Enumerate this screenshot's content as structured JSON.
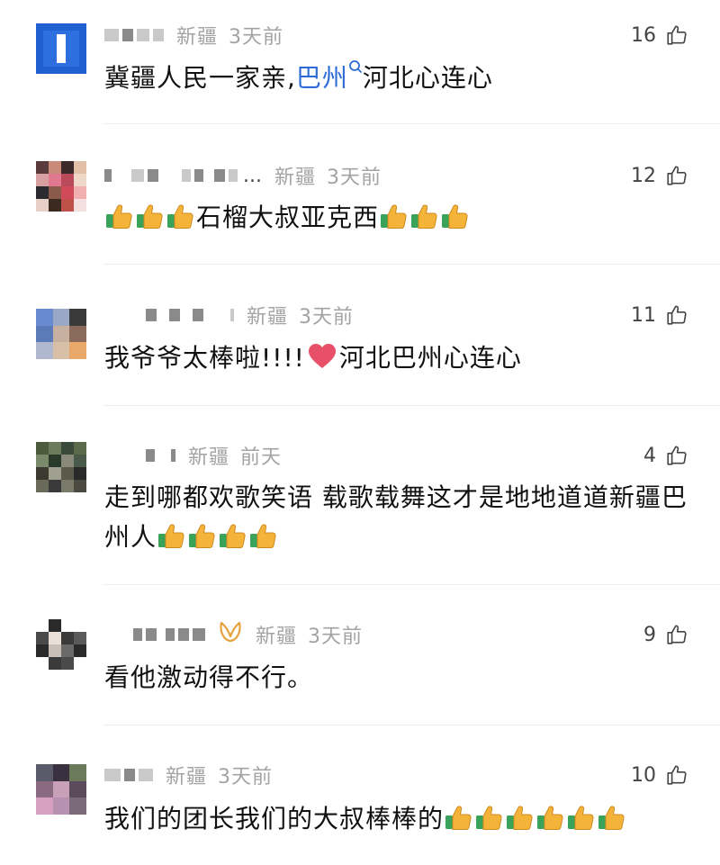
{
  "comments": [
    {
      "location": "新疆",
      "time": "3天前",
      "likes": "16",
      "segments": [
        {
          "type": "text",
          "value": "冀疆人民一家亲,"
        },
        {
          "type": "link",
          "value": "巴州"
        },
        {
          "type": "search"
        },
        {
          "type": "text",
          "value": "河北心连心"
        }
      ]
    },
    {
      "name_suffix": "...",
      "location": "新疆",
      "time": "3天前",
      "likes": "12",
      "segments": [
        {
          "type": "thumbs",
          "count": 3
        },
        {
          "type": "text",
          "value": "石榴大叔亚克西"
        },
        {
          "type": "thumbs",
          "count": 3
        }
      ]
    },
    {
      "location": "新疆",
      "time": "3天前",
      "likes": "11",
      "segments": [
        {
          "type": "text",
          "value": "我爷爷太棒啦!!!!"
        },
        {
          "type": "heart"
        },
        {
          "type": "text",
          "value": "河北巴州心连心"
        }
      ]
    },
    {
      "location": "新疆",
      "time": "前天",
      "likes": "4",
      "segments": [
        {
          "type": "text",
          "value": "走到哪都欢歌笑语 载歌载舞这才是地地道道新疆巴州人"
        },
        {
          "type": "thumbs",
          "count": 4
        }
      ]
    },
    {
      "location": "新疆",
      "time": "3天前",
      "likes": "9",
      "badge": "vip-badge-icon",
      "segments": [
        {
          "type": "text",
          "value": "看他激动得不行。"
        }
      ]
    },
    {
      "location": "新疆",
      "time": "3天前",
      "likes": "10",
      "segments": [
        {
          "type": "text",
          "value": "我们的团长我们的大叔棒棒的"
        },
        {
          "type": "thumbs",
          "count": 6
        }
      ]
    }
  ],
  "colors": {
    "link": "#2d6bd6",
    "meta": "#a3a3a3",
    "heart": "#e8506a",
    "thumb": "#f4b43a",
    "cuff": "#3aa35a"
  },
  "icons": {
    "like": "thumbs-up-outline-icon",
    "emoji_thumb": "thumbs-up-emoji-icon",
    "emoji_heart": "heart-emoji-icon",
    "search": "search-icon"
  }
}
